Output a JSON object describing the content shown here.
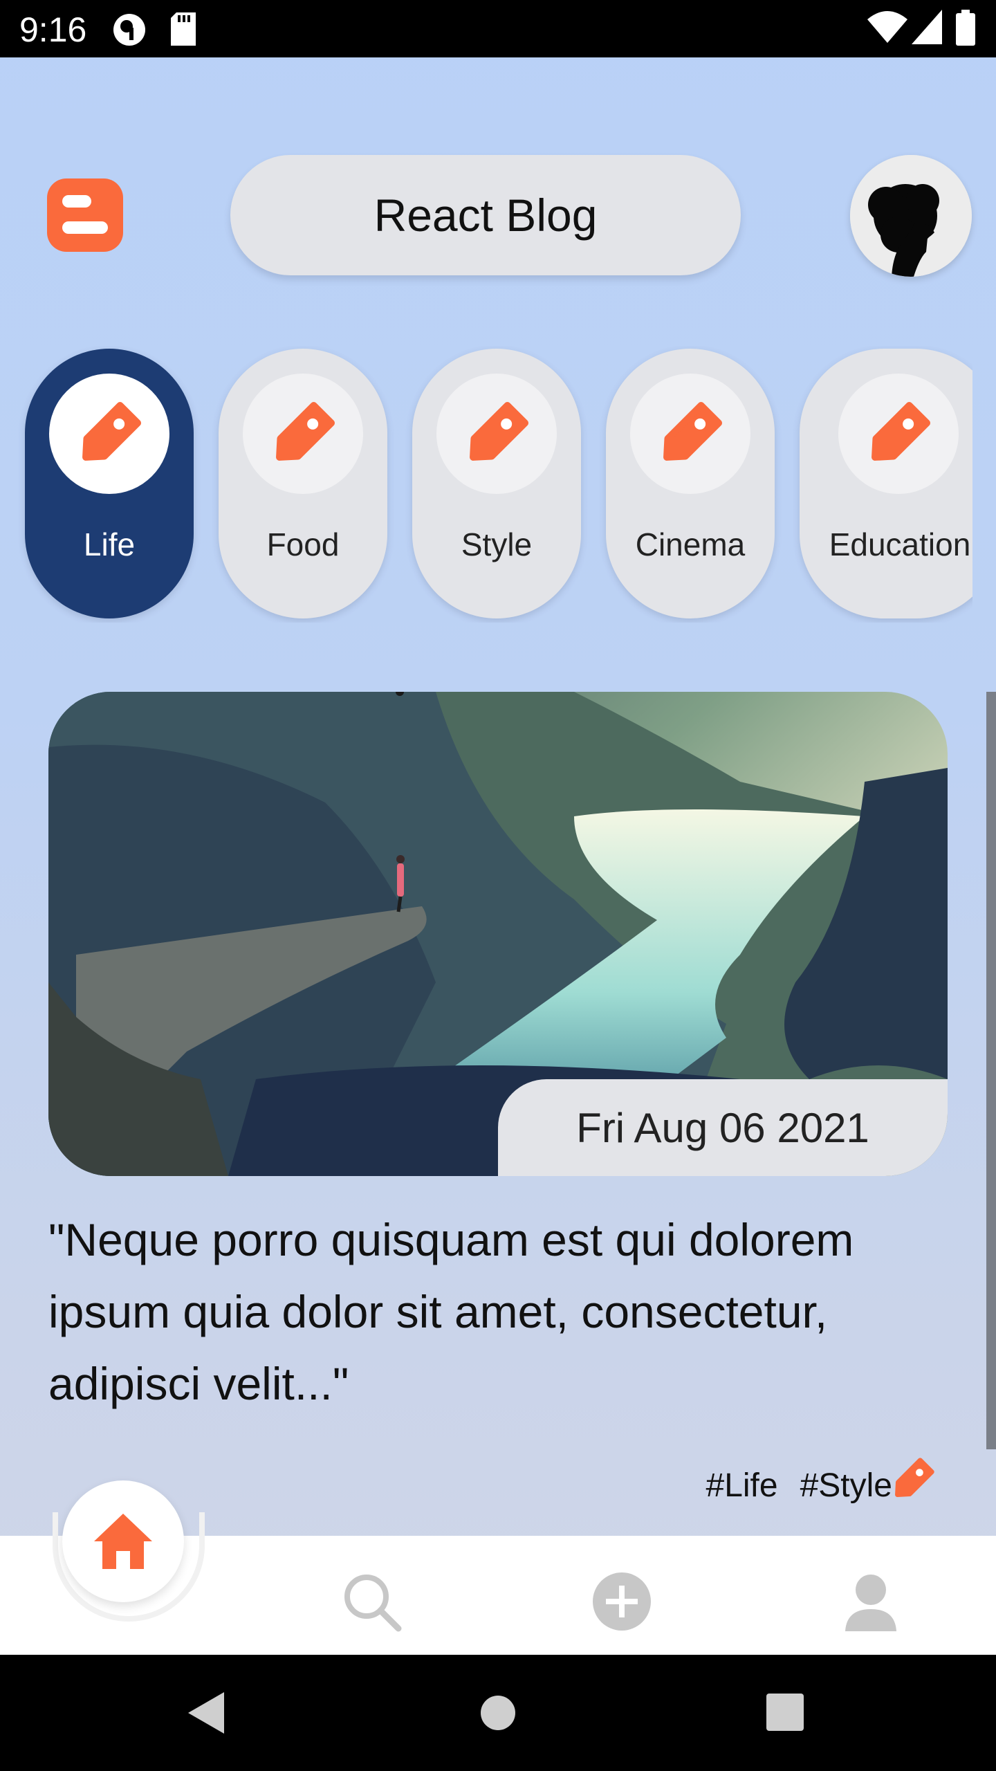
{
  "status_bar": {
    "time": "9:16",
    "icons": [
      "podcast-icon",
      "sd-card-icon",
      "wifi-icon",
      "signal-icon",
      "battery-icon"
    ]
  },
  "header": {
    "logo_icon": "blogger-logo-icon",
    "title": "React Blog",
    "avatar_icon": "user-avatar-silhouette"
  },
  "categories": [
    {
      "label": "Life",
      "active": true
    },
    {
      "label": "Food",
      "active": false
    },
    {
      "label": "Style",
      "active": false
    },
    {
      "label": "Cinema",
      "active": false
    },
    {
      "label": "Education",
      "active": false
    }
  ],
  "post": {
    "image": "cliff-fjord-yoga-photo",
    "date": "Fri Aug 06 2021",
    "excerpt": "\"Neque porro quisquam est qui dolorem ipsum quia dolor sit amet, consectetur, adipisci velit...\"",
    "tags": [
      "#Life",
      "#Style"
    ]
  },
  "bottom_nav": [
    {
      "icon": "home-icon",
      "active": true
    },
    {
      "icon": "search-icon",
      "active": false
    },
    {
      "icon": "add-circle-icon",
      "active": false
    },
    {
      "icon": "profile-icon",
      "active": false
    }
  ],
  "colors": {
    "accent": "#fa6a3c",
    "active_category": "#1d3c73",
    "pill": "#e3e4e8",
    "inactive_icon": "#c7c7c7"
  }
}
